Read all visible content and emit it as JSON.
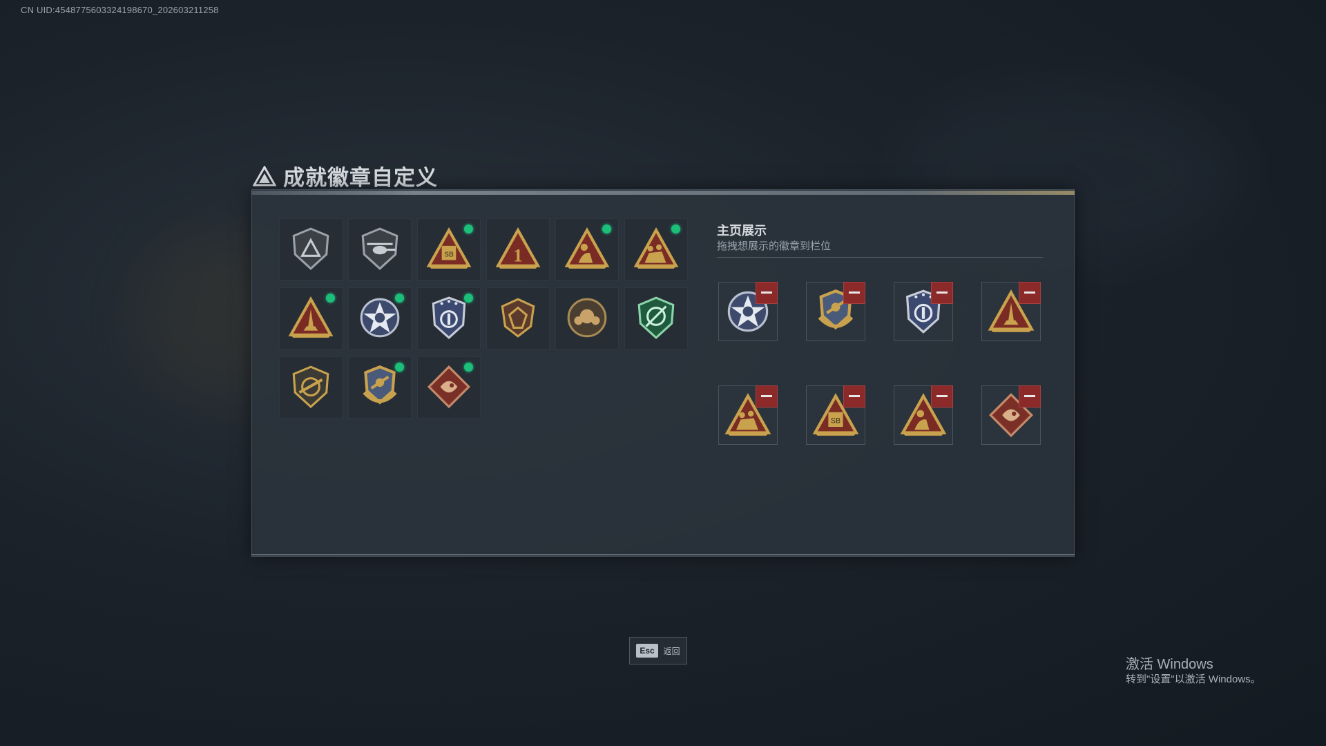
{
  "uid": "CN UID:4548775603324198670_202603211258",
  "title": "成就徽章自定义",
  "inventory": [
    {
      "name": "shield-triangle-badge",
      "selected": false
    },
    {
      "name": "helicopter-badge",
      "selected": false
    },
    {
      "name": "sb-triangle-badge",
      "selected": true
    },
    {
      "name": "number-one-badge",
      "selected": false
    },
    {
      "name": "soldier-triangle-badge",
      "selected": true
    },
    {
      "name": "squad-triangle-badge",
      "selected": true
    },
    {
      "name": "rocket-triangle-badge",
      "selected": true
    },
    {
      "name": "star-wings-badge",
      "selected": true
    },
    {
      "name": "police-shield-badge",
      "selected": true
    },
    {
      "name": "gem-shield-badge",
      "selected": false
    },
    {
      "name": "fist-emblem-badge",
      "selected": false
    },
    {
      "name": "green-crosshair-badge",
      "selected": false
    },
    {
      "name": "rifle-shield-badge",
      "selected": false
    },
    {
      "name": "gold-crest-badge",
      "selected": true
    },
    {
      "name": "dragon-diamond-badge",
      "selected": true
    }
  ],
  "showcase": {
    "title": "主页展示",
    "subtitle": "拖拽想展示的徽章到栏位",
    "slots": [
      "star-wings-badge",
      "gold-crest-badge",
      "police-shield-badge",
      "rocket-triangle-badge",
      "squad-triangle-badge",
      "sb-triangle-badge",
      "soldier-triangle-badge",
      "dragon-diamond-badge"
    ]
  },
  "footer": {
    "key": "Esc",
    "label": "返回"
  },
  "windows_watermark": {
    "title": "激活 Windows",
    "subtitle": "转到\"设置\"以激活 Windows。"
  },
  "colors": {
    "accent_green": "#1bbf7a",
    "remove_red": "#8c2a2a",
    "gold": "#c9a24e"
  }
}
